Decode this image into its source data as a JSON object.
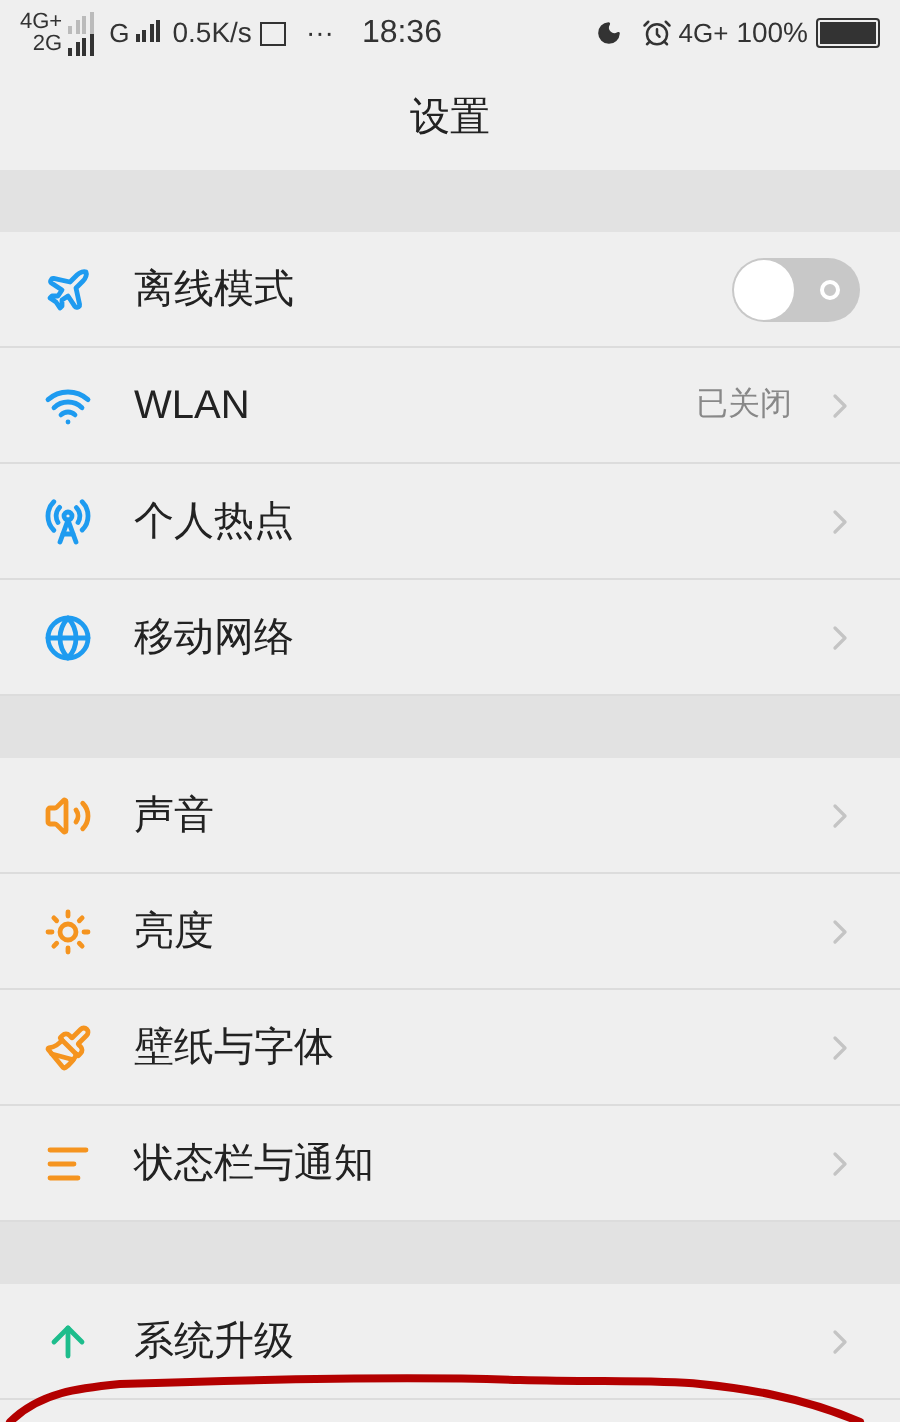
{
  "status_bar": {
    "network_1": "4G+",
    "network_2": "2G",
    "network_3": "G",
    "speed": "0.5K/s",
    "more": "···",
    "time": "18:36",
    "network_4": "4G+",
    "battery": "100%"
  },
  "title": "设置",
  "sections": [
    {
      "items": [
        {
          "kind": "toggle",
          "label": "离线模式",
          "on": false
        },
        {
          "kind": "link",
          "label": "WLAN",
          "value": "已关闭"
        },
        {
          "kind": "link",
          "label": "个人热点"
        },
        {
          "kind": "link",
          "label": "移动网络"
        }
      ]
    },
    {
      "items": [
        {
          "kind": "link",
          "label": "声音"
        },
        {
          "kind": "link",
          "label": "亮度"
        },
        {
          "kind": "link",
          "label": "壁纸与字体"
        },
        {
          "kind": "link",
          "label": "状态栏与通知"
        }
      ]
    },
    {
      "items": [
        {
          "kind": "link",
          "label": "系统升级"
        }
      ]
    }
  ]
}
